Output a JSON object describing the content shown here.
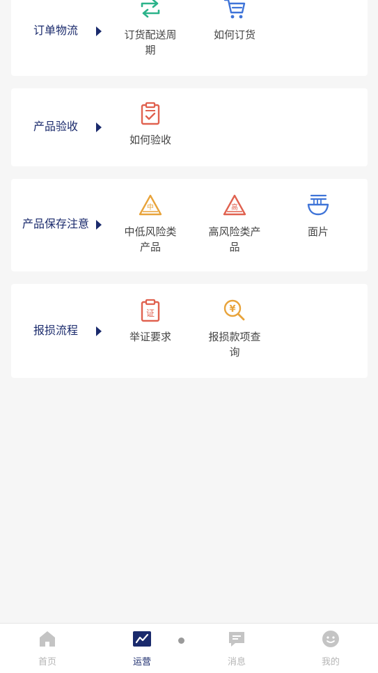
{
  "sections": [
    {
      "title": "订单物流",
      "items": [
        {
          "label": "订货配送周期",
          "icon": "swap-arrows-icon"
        },
        {
          "label": "如何订货",
          "icon": "shopping-cart-icon"
        }
      ]
    },
    {
      "title": "产品验收",
      "items": [
        {
          "label": "如何验收",
          "icon": "checklist-clipboard-icon"
        }
      ]
    },
    {
      "title": "产品保存注意",
      "items": [
        {
          "label": "中低风险类产品",
          "icon": "warning-medium-icon",
          "glyph": "中"
        },
        {
          "label": "高风险类产品",
          "icon": "warning-high-icon",
          "glyph": "高"
        },
        {
          "label": "面片",
          "icon": "noodle-bowl-icon"
        }
      ]
    },
    {
      "title": "报损流程",
      "items": [
        {
          "label": "举证要求",
          "icon": "evidence-clipboard-icon",
          "glyph": "证"
        },
        {
          "label": "报损款项查询",
          "icon": "money-search-icon",
          "glyph": "¥"
        }
      ]
    }
  ],
  "tabbar": {
    "tabs": [
      {
        "label": "首页",
        "icon": "home-icon"
      },
      {
        "label": "运营",
        "icon": "chart-icon",
        "active": true
      },
      {
        "label": "消息",
        "icon": "message-icon"
      },
      {
        "label": "我的",
        "icon": "profile-icon"
      }
    ]
  },
  "colors": {
    "title": "#1a2a6c",
    "green": "#2bb38a",
    "blue": "#3f74d8",
    "red": "#e0614f",
    "orange": "#e8a33a",
    "tab_inactive": "#b5b5b5"
  }
}
